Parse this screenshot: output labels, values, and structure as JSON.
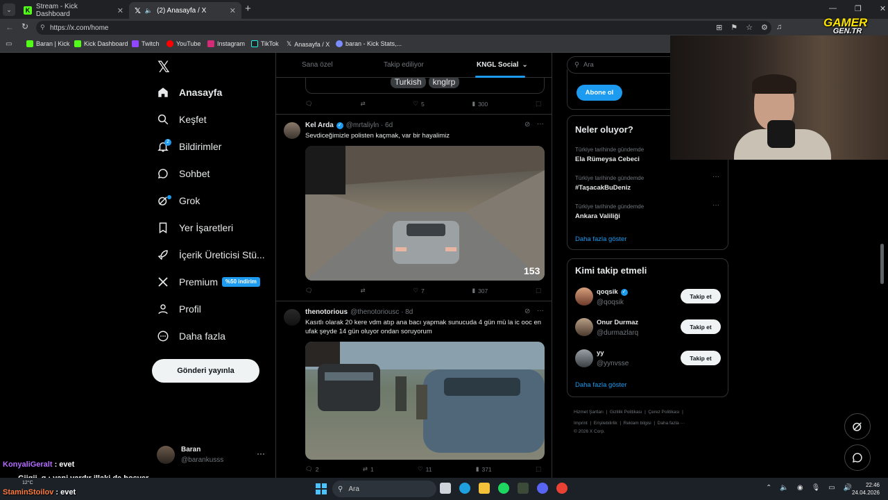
{
  "browser": {
    "tabs": [
      {
        "title": "Stream - Kick Dashboard"
      },
      {
        "title": "(2) Anasayfa / X"
      }
    ],
    "url": "https://x.com/home",
    "bookmarks": [
      "Baran | Kick",
      "Kick Dashboard",
      "Twitch",
      "YouTube",
      "Instagram",
      "TikTok",
      "Anasayfa / X",
      "baran - Kick Stats,..."
    ]
  },
  "overlay": {
    "logo_top": "GAMER",
    "logo_bottom": "GEN.TR"
  },
  "sidebar": {
    "items": [
      {
        "label": "Anasayfa",
        "icon": "home-icon"
      },
      {
        "label": "Keşfet",
        "icon": "search-icon"
      },
      {
        "label": "Bildirimler",
        "icon": "bell-icon",
        "badge": "2"
      },
      {
        "label": "Sohbet",
        "icon": "chat-icon"
      },
      {
        "label": "Grok",
        "icon": "grok-icon"
      },
      {
        "label": "Yer İşaretleri",
        "icon": "bookmark-icon"
      },
      {
        "label": "İçerik Üreticisi Stü...",
        "icon": "rocket-icon"
      },
      {
        "label": "Premium",
        "icon": "x-icon",
        "badge": "%50 indirim"
      },
      {
        "label": "Profil",
        "icon": "person-icon"
      },
      {
        "label": "Daha fazla",
        "icon": "more-circle-icon"
      }
    ],
    "post_button": "Gönderi yayınla",
    "account": {
      "name": "Baran",
      "handle": "@barankusss"
    }
  },
  "feed": {
    "tabs": [
      "Sana özel",
      "Takip ediliyor",
      "KNGL Social"
    ],
    "top_tags": [
      "Turkish",
      "knglrp"
    ],
    "top_stats": {
      "reply": "",
      "retweet": "",
      "like": "5",
      "views": "300"
    },
    "tweets": [
      {
        "name": "Kel Arda",
        "handle": "@mrtaliyln · 6d",
        "text": "Sevdiceğimizle polisten kaçmak, var bir hayalimiz",
        "media_counter": "153",
        "stats": {
          "reply": "",
          "retweet": "",
          "like": "7",
          "views": "307"
        }
      },
      {
        "name": "thenotorious",
        "handle": "@thenotoriousc · 8d",
        "text": "Kasıtlı olarak 20 kere vdm atıp ana bacı yapmak sunucuda 4 gün mü la ic ooc en ufak şeyde 14 gün oluyor ondan soruyorum",
        "stats": {
          "reply": "2",
          "retweet": "1",
          "like": "11",
          "views": "371"
        }
      }
    ]
  },
  "right": {
    "search_placeholder": "Ara",
    "subscribe": "Abone ol",
    "trends_title": "Neler oluyor?",
    "trends": [
      {
        "sub": "Türkiye tarihinde gündemde",
        "title": "Ela Rümeysa Cebeci"
      },
      {
        "sub": "Türkiye tarihinde gündemde",
        "title": "#TaşacakBuDeniz"
      },
      {
        "sub": "Türkiye tarihinde gündemde",
        "title": "Ankara Valiliği"
      }
    ],
    "show_more": "Daha fazla göster",
    "follow_title": "Kimi takip etmeli",
    "follow": [
      {
        "name": "qoqsik",
        "handle": "@qoqsik",
        "btn": "Takip et"
      },
      {
        "name": "Onur Durmaz",
        "handle": "@durmazlarq",
        "btn": "Takip et"
      },
      {
        "name": "yy",
        "handle": "@yynvsse",
        "btn": "Takip et"
      }
    ],
    "footer1": "Hizmet Şartları  |  Gizlilik Politikası  |  Çerez Politikası  |",
    "footer2": "Imprint  |  Erişilebilirlik  |  Reklam bilgisi  |  Daha fazla ···",
    "footer3": "© 2026 X Corp."
  },
  "chat": [
    {
      "user": "KonyaliGeralt",
      "msg": " : evet",
      "color": "#b46bff"
    },
    {
      "user": "Giigii_g",
      "msg": " : yani vardır illaki de bosver",
      "color": "#ffffff"
    },
    {
      "user": "StaminStoilov",
      "msg": " : evet",
      "color": "#ff7a3d"
    }
  ],
  "taskbar": {
    "search": "Ara",
    "temp": "12°C",
    "time": "22:46",
    "date": "24.04.2026"
  }
}
